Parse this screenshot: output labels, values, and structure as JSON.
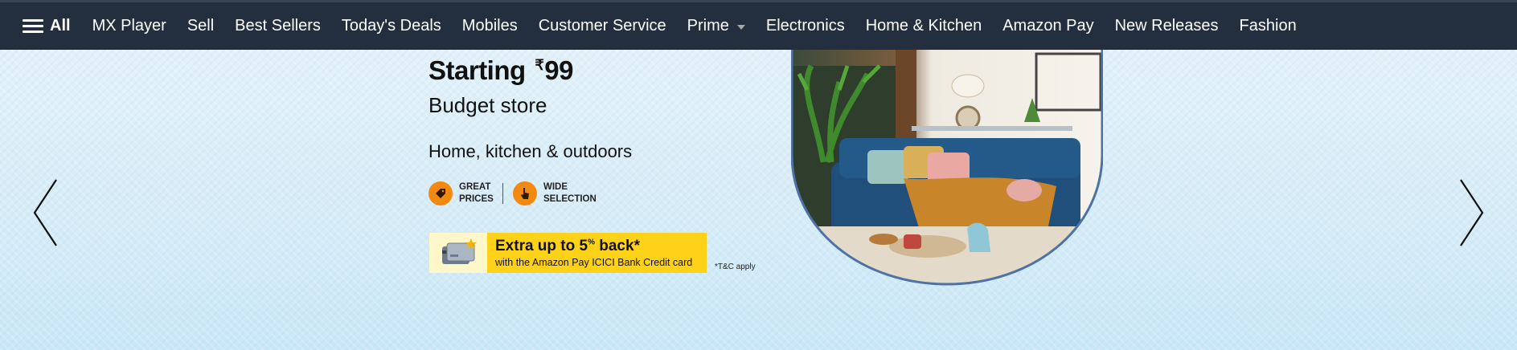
{
  "nav": {
    "all_label": "All",
    "items": [
      {
        "label": "MX Player"
      },
      {
        "label": "Sell"
      },
      {
        "label": "Best Sellers"
      },
      {
        "label": "Today's Deals"
      },
      {
        "label": "Mobiles"
      },
      {
        "label": "Customer Service"
      },
      {
        "label": "Prime"
      },
      {
        "label": "Electronics"
      },
      {
        "label": "Home & Kitchen"
      },
      {
        "label": "Amazon Pay"
      },
      {
        "label": "New Releases"
      },
      {
        "label": "Fashion"
      }
    ]
  },
  "banner": {
    "headline": "Starting",
    "currency_symbol": "₹",
    "price": "99",
    "subhead": "Budget store",
    "tagline": "Home, kitchen & outdoors",
    "badge1_line1": "GREAT",
    "badge1_line2": "PRICES",
    "badge2_line1": "WIDE",
    "badge2_line2": "SELECTION",
    "offer_main": "Extra up to 5",
    "offer_percent": "%",
    "offer_main_end": " back*",
    "offer_sub": "with the Amazon Pay ICICI Bank Credit card",
    "tnc": "*T&C apply"
  },
  "icons": {
    "menu": "hamburger-icon",
    "prime_caret": "caret-down-icon",
    "prev": "chevron-left-icon",
    "next": "chevron-right-icon",
    "price_tag": "price-tag-icon",
    "selection": "pointer-hand-icon",
    "credit_card": "credit-card-icon"
  },
  "colors": {
    "nav_bg": "#232f3e",
    "accent_orange": "#f28a12",
    "offer_yellow": "#ffd21a",
    "sofa_blue": "#1f4f7a"
  }
}
